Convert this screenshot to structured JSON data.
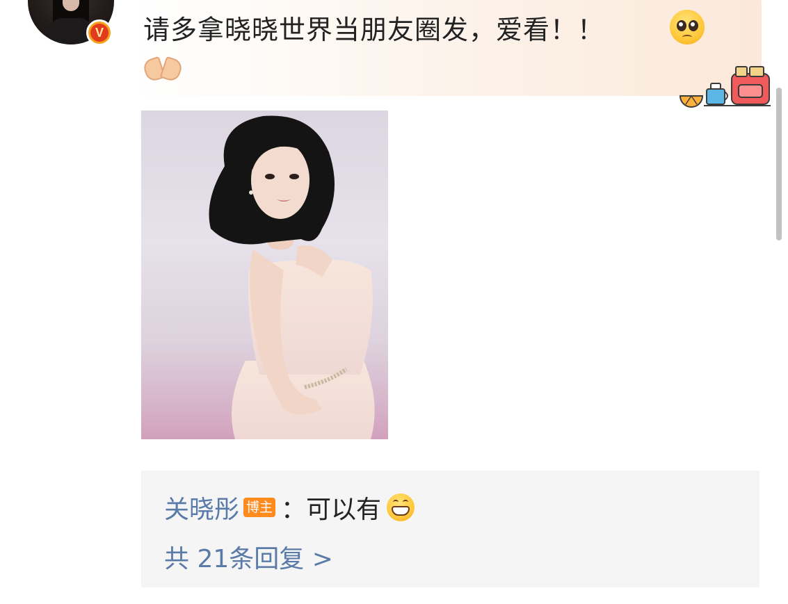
{
  "comment": {
    "text": "请多拿晓晓世界当朋友圈发，爱看！！",
    "emoji_trailing": "pleading-face",
    "emoji_second_line": "heart-hands"
  },
  "avatar": {
    "verified_badge": "V"
  },
  "decoration": "breakfast-toaster",
  "photo": {
    "subject": "woman-in-pink-dress-portrait"
  },
  "reply": {
    "author": "关晓彤",
    "author_badge": "博主",
    "separator": "：",
    "text": "可以有",
    "emoji": "grinning-face",
    "more_link": "共 21条回复 >"
  },
  "colors": {
    "link_blue": "#5a7aa8",
    "badge_orange": "#ff8a1e",
    "reply_bg": "#f5f5f5",
    "verified_gold": "#f5a21d"
  }
}
